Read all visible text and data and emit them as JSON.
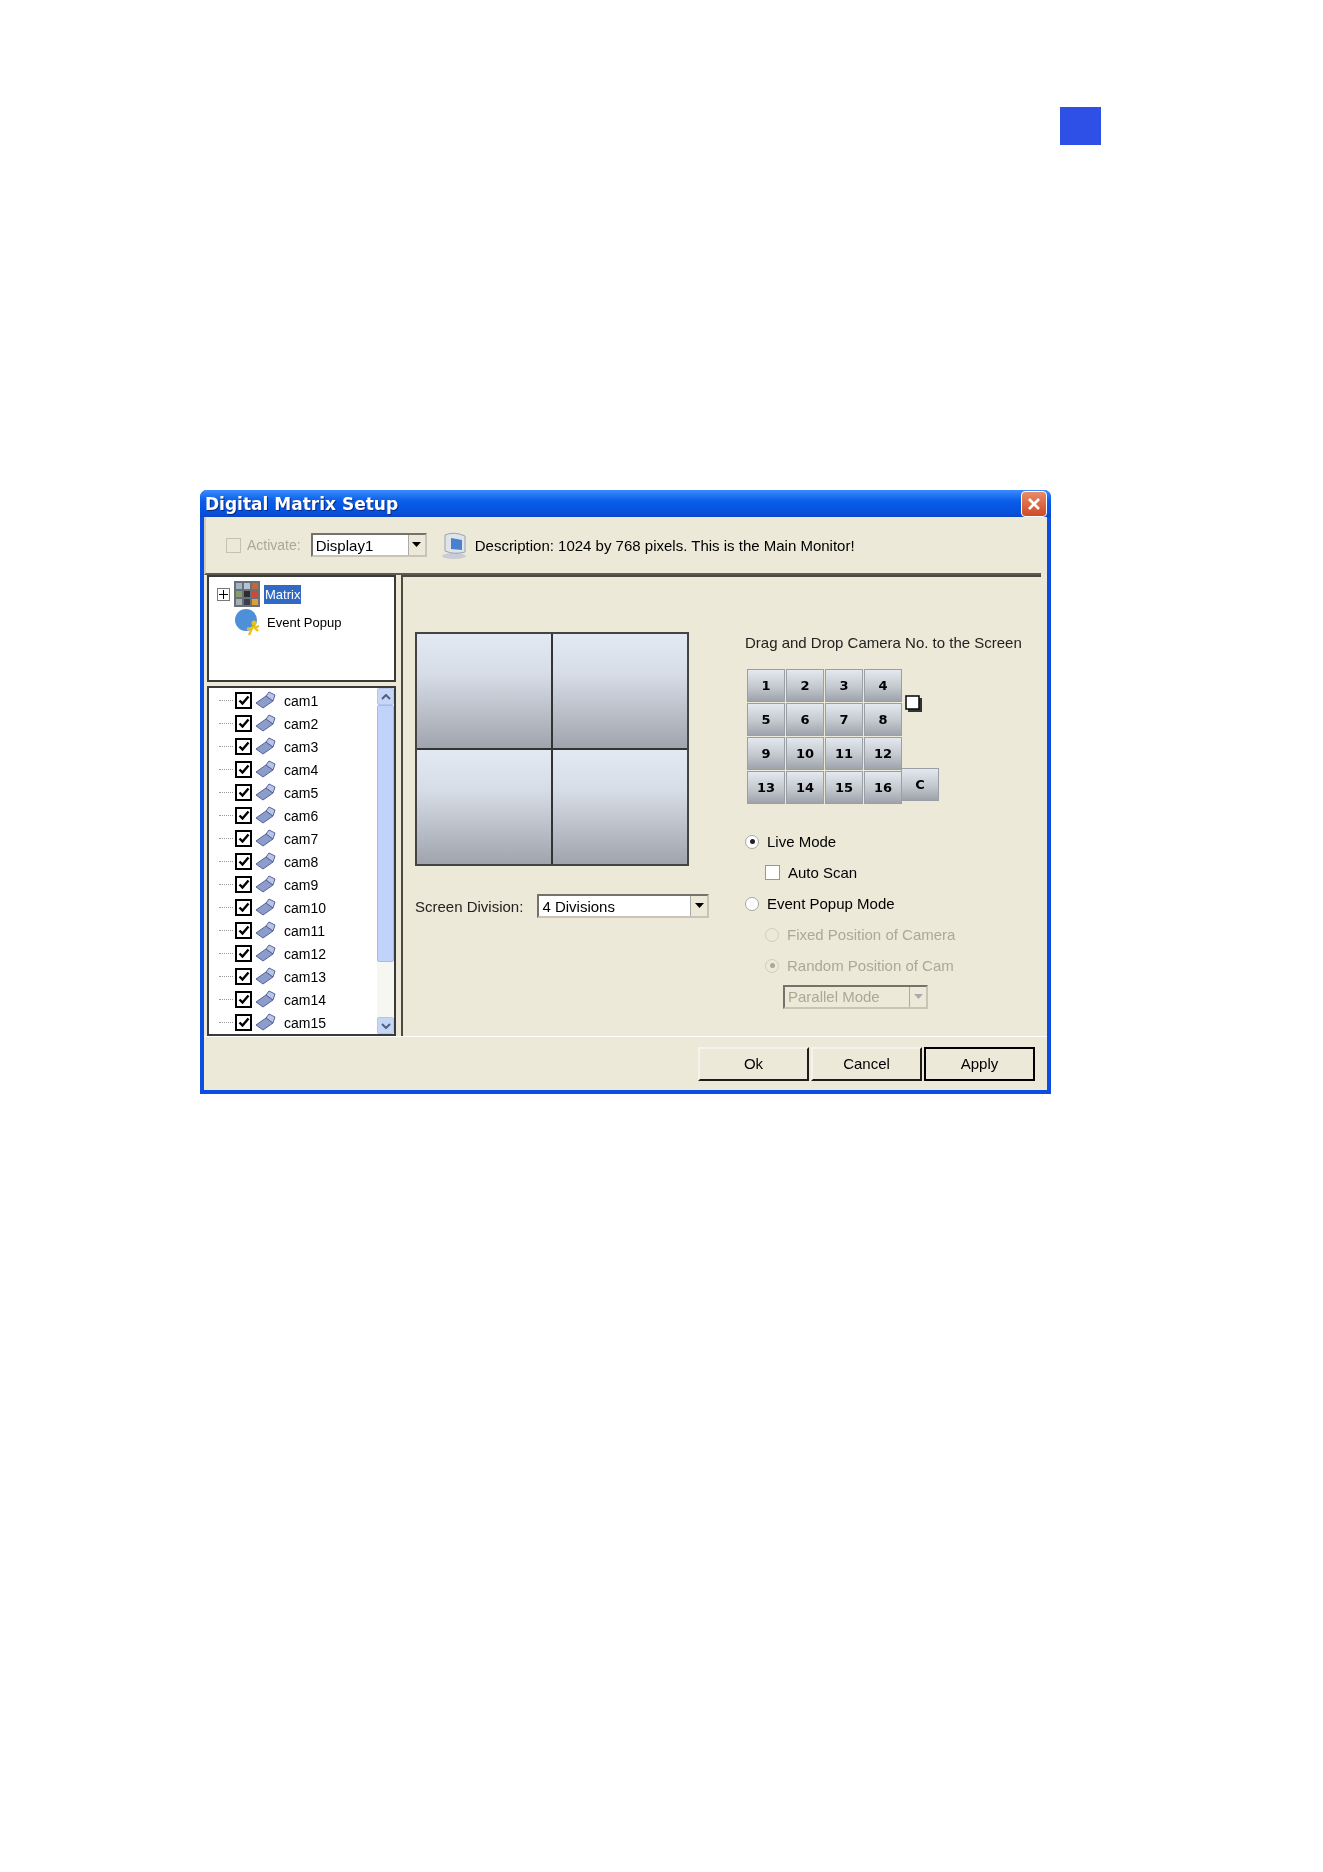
{
  "dialog": {
    "title": "Digital Matrix Setup",
    "toolbar": {
      "activate": {
        "label": "Activate:",
        "checked": false,
        "disabled": true
      },
      "display": {
        "value": "Display1"
      },
      "description": "Description: 1024 by 768 pixels. This is the Main Monitor!"
    },
    "tree": [
      {
        "label": "Matrix",
        "kind": "matrix",
        "selected": true,
        "expanded": false
      },
      {
        "label": "Event Popup",
        "kind": "event",
        "selected": false
      }
    ],
    "cameras": [
      {
        "label": "cam1",
        "checked": true
      },
      {
        "label": "cam2",
        "checked": true
      },
      {
        "label": "cam3",
        "checked": true
      },
      {
        "label": "cam4",
        "checked": true
      },
      {
        "label": "cam5",
        "checked": true
      },
      {
        "label": "cam6",
        "checked": true
      },
      {
        "label": "cam7",
        "checked": true
      },
      {
        "label": "cam8",
        "checked": true
      },
      {
        "label": "cam9",
        "checked": true
      },
      {
        "label": "cam10",
        "checked": true
      },
      {
        "label": "cam11",
        "checked": true
      },
      {
        "label": "cam12",
        "checked": true
      },
      {
        "label": "cam13",
        "checked": true
      },
      {
        "label": "cam14",
        "checked": true
      },
      {
        "label": "cam15",
        "checked": true
      }
    ],
    "screen_division": {
      "label": "Screen Division:",
      "value": "4 Divisions"
    },
    "drag_hint": "Drag and Drop Camera No. to the Screen",
    "camera_numbers": [
      "1",
      "2",
      "3",
      "4",
      "5",
      "6",
      "7",
      "8",
      "9",
      "10",
      "11",
      "12",
      "13",
      "14",
      "15",
      "16"
    ],
    "clear_key": "C",
    "modes": [
      {
        "label": "Live Mode",
        "kind": "radio",
        "selected": true,
        "disabled": false,
        "children": [
          {
            "label": "Auto Scan",
            "kind": "checkbox",
            "checked": false,
            "disabled": false
          }
        ]
      },
      {
        "label": "Event Popup Mode",
        "kind": "radio",
        "selected": false,
        "disabled": false,
        "children": [
          {
            "label": "Fixed Position of Camera",
            "kind": "radio",
            "selected": false,
            "disabled": true
          },
          {
            "label": "Random Position of Cam",
            "kind": "radio",
            "selected": true,
            "disabled": true
          },
          {
            "label": "Parallel Mode",
            "kind": "select",
            "disabled": true
          }
        ]
      }
    ],
    "buttons": [
      {
        "label": "Ok",
        "focused": false
      },
      {
        "label": "Cancel",
        "focused": false
      },
      {
        "label": "Apply",
        "focused": true
      }
    ]
  }
}
